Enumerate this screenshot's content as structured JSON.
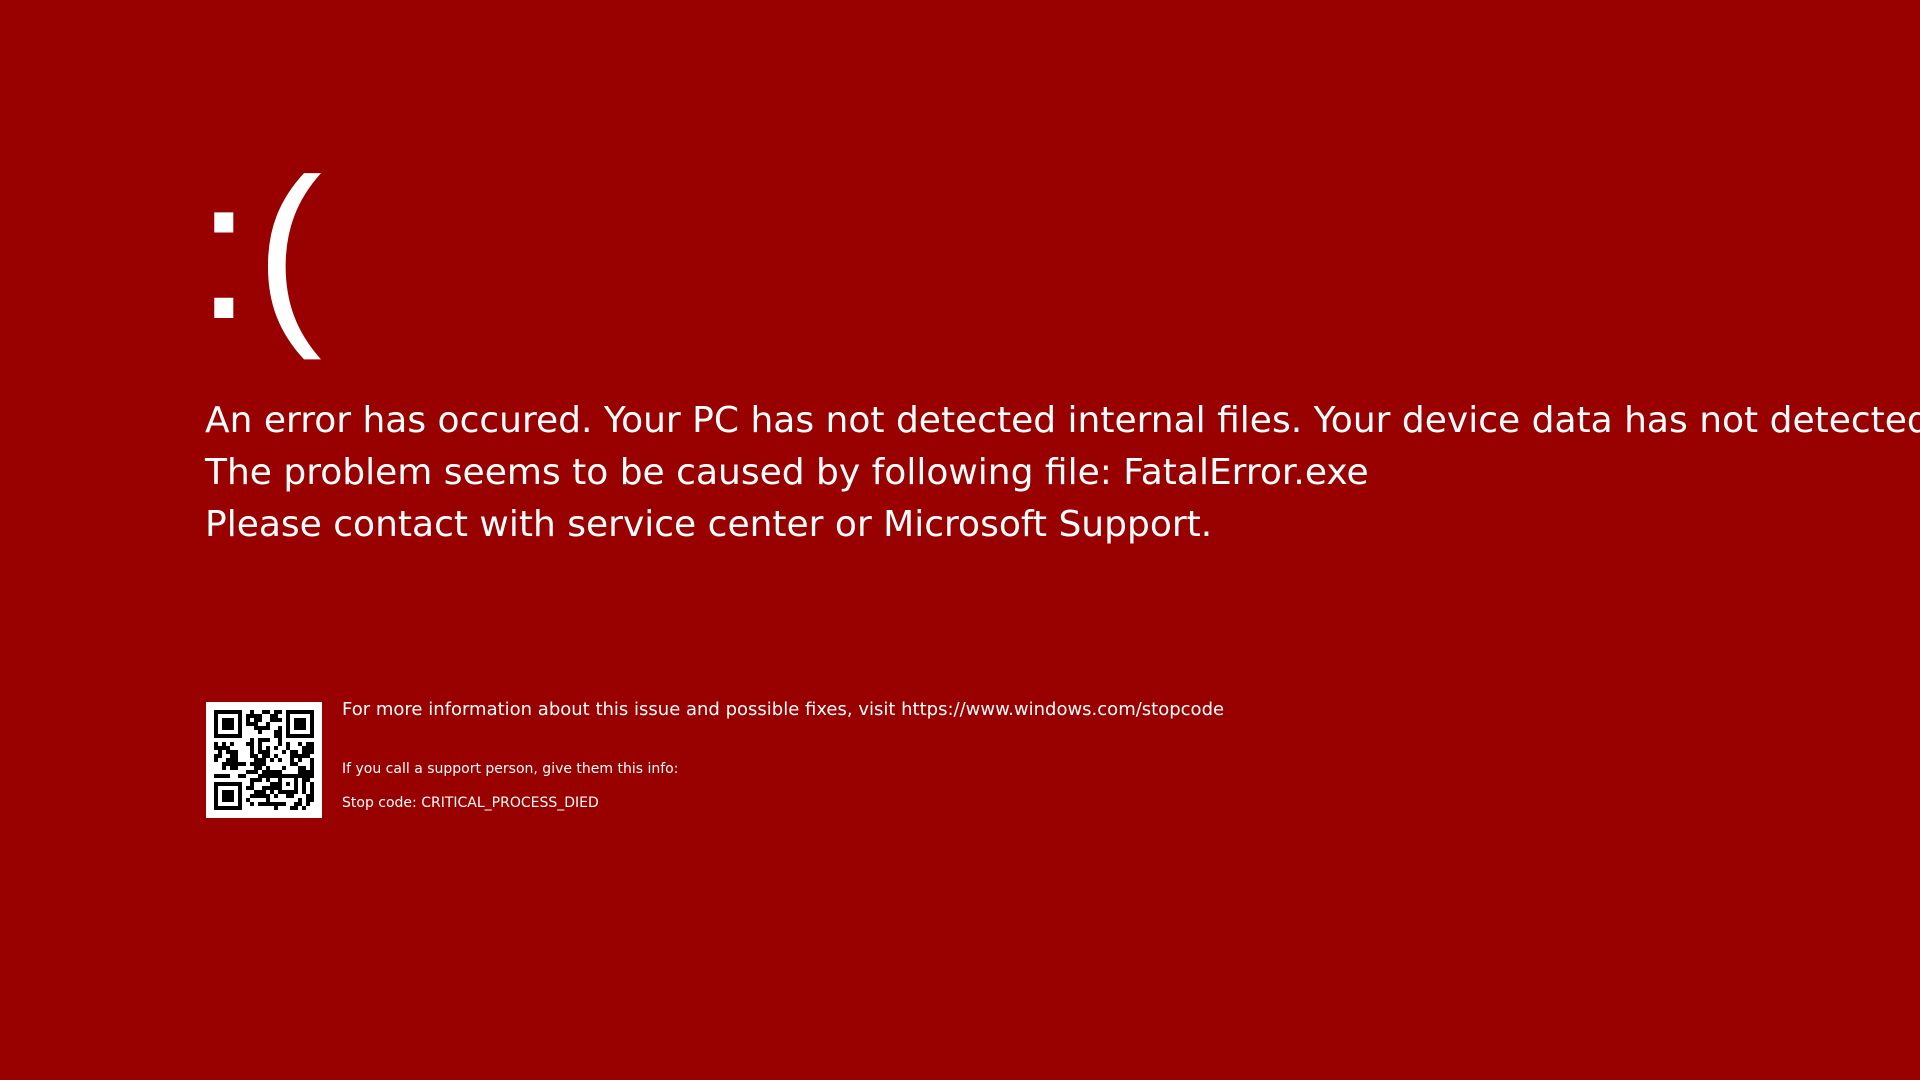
{
  "screen": {
    "background_color": "#990000",
    "text_color": "#ffffff",
    "emoticon": ":("
  },
  "message": {
    "lines": [
      "An error has occured. Your PC has not detected internal files. Your device data has not detected.",
      "The problem seems to be caused by following file: FatalError.exe",
      "Please contact with service center or Microsoft Support."
    ]
  },
  "info": {
    "qr_icon": "qr-code-icon",
    "more_info_text": "For more information about this issue and possible fixes, visit https://www.windows.com/stopcode",
    "support_text": "If you call a support person, give them this info:",
    "stop_code_label": "Stop code:",
    "stop_code_value": "CRITICAL_PROCESS_DIED"
  }
}
